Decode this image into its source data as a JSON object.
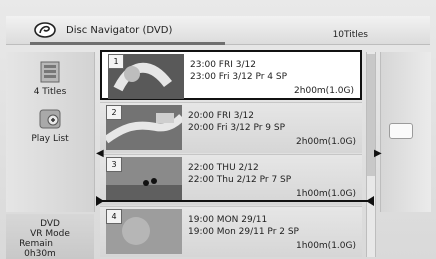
{
  "header": {
    "title": "Disc Navigator (DVD)",
    "count": "10Titles"
  },
  "left": {
    "items": [
      {
        "label": "4 Titles",
        "icon": "titles-list-icon"
      },
      {
        "label": "Play List",
        "icon": "playlist-icon"
      }
    ],
    "bottom": {
      "disc": "DVD",
      "mode": "VR Mode",
      "remain_label": "Remain",
      "remain_value": "0h30m"
    }
  },
  "titles": [
    {
      "num": "1",
      "line1": "23:00 FRI 3/12",
      "line2": "23:00  Fri  3/12  Pr 4  SP",
      "duration": "2h00m(1.0G)"
    },
    {
      "num": "2",
      "line1": "20:00 FRI 3/12",
      "line2": "20:00  Fri  3/12  Pr 9  SP",
      "duration": "2h00m(1.0G)"
    },
    {
      "num": "3",
      "line1": "22:00 THU 2/12",
      "line2": "22:00  Thu  2/12  Pr 7  SP",
      "duration": "1h00m(1.0G)"
    },
    {
      "num": "4",
      "line1": "19:00 MON 29/11",
      "line2": "19:00  Mon  29/11  Pr 2  SP",
      "duration": "1h00m(1.0G)"
    }
  ],
  "colors": {
    "panel": "#d9d9d9",
    "selected_bg": "#ffffff",
    "selected_border": "#111111"
  }
}
